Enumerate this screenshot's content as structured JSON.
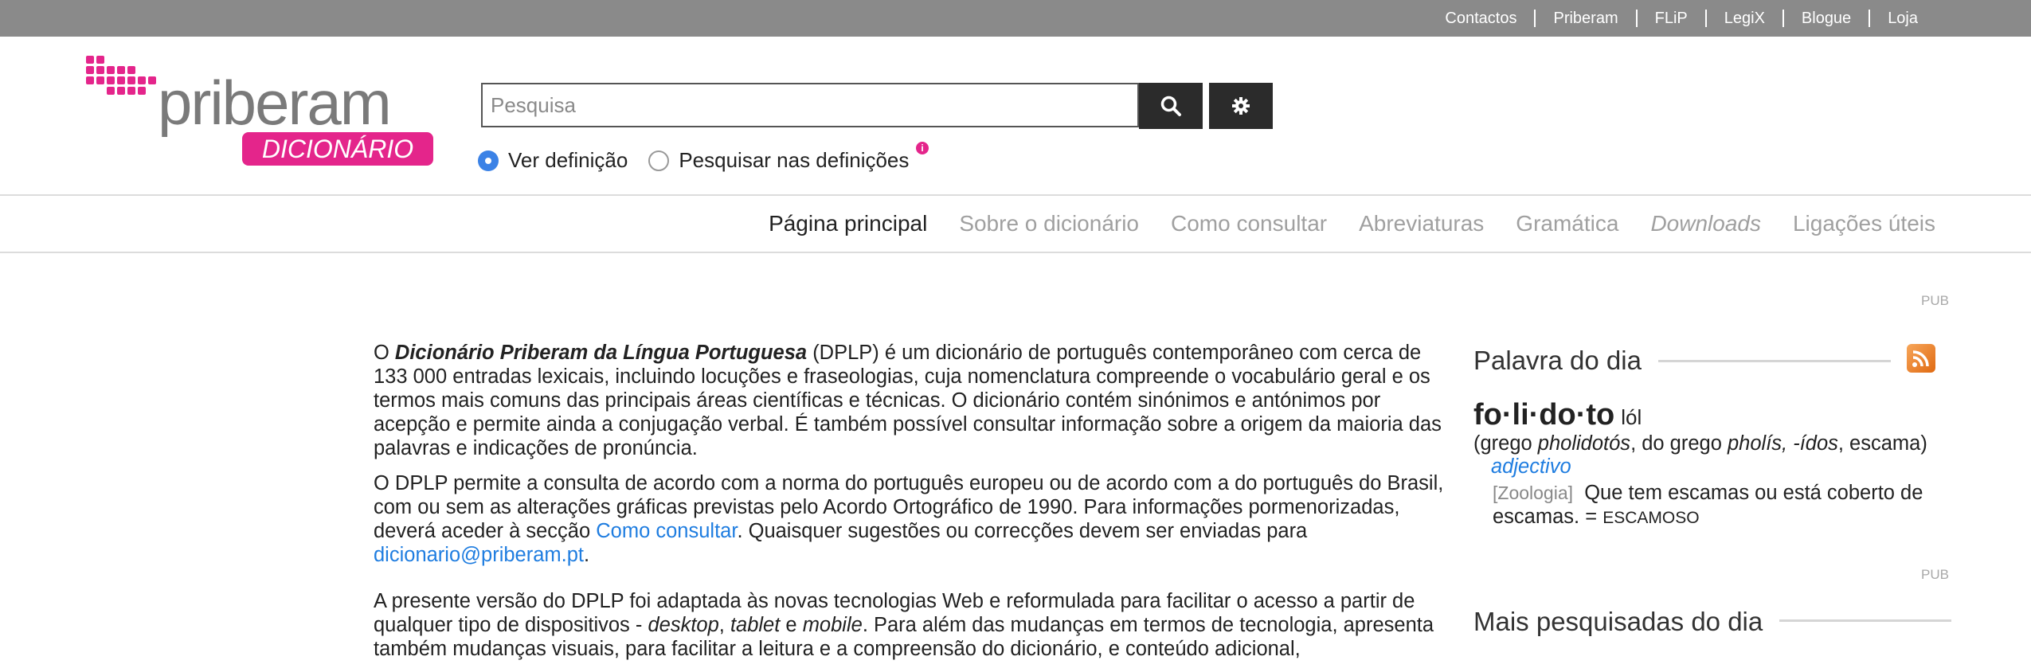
{
  "topnav": [
    "Contactos",
    "Priberam",
    "FLiP",
    "LegiX",
    "Blogue",
    "Loja"
  ],
  "logo": {
    "word": "priberam",
    "badge": "DICIONÁRIO",
    "brand_color": "#e4258b",
    "gray_color": "#7a7a7a"
  },
  "search": {
    "placeholder": "Pesquisa",
    "value": ""
  },
  "search_button_icon": "search-icon",
  "settings_button_icon": "gear-icon",
  "radios": [
    {
      "label": "Ver definição",
      "checked": true
    },
    {
      "label": "Pesquisar nas definições",
      "checked": false
    }
  ],
  "info_icon": "info-icon",
  "mainnav": [
    "Página principal",
    "Sobre o dicionário",
    "Como consultar",
    "Abreviaturas",
    "Gramática",
    "Downloads",
    "Ligações úteis"
  ],
  "content": {
    "p1": {
      "a": "O ",
      "b": "Dicionário Priberam da Língua Portuguesa",
      "c": " (DPLP) é um dicionário de português contemporâneo com cerca de 133 000 entradas lexicais, incluindo locuções e fraseologias, cuja nomenclatura compreende o vocabulário geral e os termos mais comuns das principais áreas científicas e técnicas. O dicionário contém sinónimos e antónimos por acepção e permite ainda a conjugação verbal. É também possível consultar informação sobre a origem da maioria das palavras e indicações de pronúncia."
    },
    "p2": {
      "a": "O DPLP permite a consulta de acordo com a norma do português europeu ou de acordo com a do português do Brasil, com ou sem as alterações gráficas previstas pelo Acordo Ortográfico de 1990. Para informações pormenorizadas, deverá aceder à secção ",
      "link1": "Como consultar",
      "b": ". Quaisquer sugestões ou correcções devem ser enviadas para ",
      "link2": "dicionario@priberam.pt",
      "c": "."
    },
    "p3": {
      "a": "A presente versão do DPLP foi adaptada às novas tecnologias Web e reformulada para facilitar o acesso a partir de qualquer tipo de dispositivos - ",
      "i1": "desktop",
      "b": ", ",
      "i2": "tablet",
      "c": " e ",
      "i3": "mobile",
      "d": ". Para além das mudanças em termos de tecnologia, apresenta também mudanças visuais, para facilitar a leitura e a compreensão do dicionário, e conteúdo adicional,"
    }
  },
  "sidebar": {
    "pub1": "PUB",
    "pub2": "PUB",
    "word_of_day_title": "Palavra do dia",
    "rss_icon": "rss-icon",
    "word": "fo·li·do·to",
    "pron": "lól",
    "etym": {
      "a": "(grego ",
      "i1": "pholidotós",
      "b": ", do grego ",
      "i2": "pholís, -ídos",
      "c": ", escama)"
    },
    "pos": "adjectivo",
    "domain": "[Zoologia]",
    "definition": "Que tem escamas ou está coberto de escamas. = ",
    "synonym": "ESCAMOSO",
    "most_searched_title": "Mais pesquisadas do dia"
  }
}
